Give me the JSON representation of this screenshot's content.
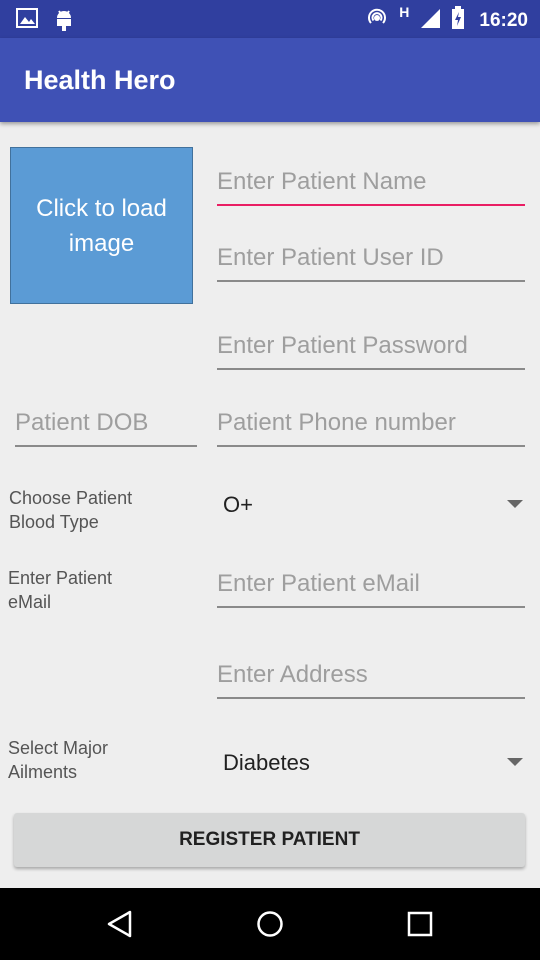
{
  "status_bar": {
    "time": "16:20",
    "network_label": "H",
    "icons": [
      "image-icon",
      "android-icon",
      "hotspot-icon",
      "signal-icon",
      "battery-icon"
    ]
  },
  "app_bar": {
    "title": "Health Hero"
  },
  "image_loader": {
    "label_line1": "Click to load",
    "label_line2": "image"
  },
  "form": {
    "patient_name_placeholder": "Enter Patient Name",
    "user_id_placeholder": "Enter Patient User ID",
    "password_placeholder": "Enter Patient Password",
    "dob_placeholder": "Patient DOB",
    "phone_placeholder": "Patient Phone number",
    "blood_type_label_line1": "Choose Patient",
    "blood_type_label_line2": "Blood Type",
    "blood_type_value": "O+",
    "email_label_line1": "Enter Patient",
    "email_label_line2": "eMail",
    "email_placeholder": "Enter Patient eMail",
    "address_placeholder": "Enter Address",
    "ailments_label_line1": "Select Major",
    "ailments_label_line2": "Ailments",
    "ailments_value": "Diabetes",
    "register_label": "REGISTER PATIENT"
  },
  "nav_bar": {
    "icons": [
      "back-icon",
      "home-icon",
      "recents-icon"
    ]
  },
  "colors": {
    "status_bar": "#303f9f",
    "app_bar": "#3f51b5",
    "focus_underline": "#e91e63",
    "image_box": "#5b9bd5"
  }
}
